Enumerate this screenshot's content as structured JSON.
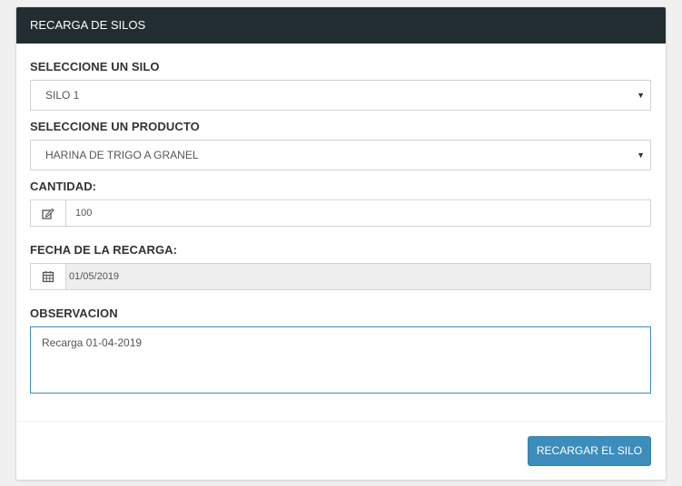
{
  "panel": {
    "title": "RECARGA DE SILOS"
  },
  "form": {
    "silo": {
      "label": "SELECCIONE UN SILO",
      "selected": "SILO 1"
    },
    "producto": {
      "label": "SELECCIONE UN PRODUCTO",
      "selected": "HARINA DE TRIGO A GRANEL"
    },
    "cantidad": {
      "label": "CANTIDAD:",
      "value": "100",
      "icon": "edit-icon"
    },
    "fecha": {
      "label": "FECHA DE LA RECARGA:",
      "value": "01/05/2019",
      "icon": "calendar-icon"
    },
    "observacion": {
      "label": "OBSERVACION",
      "value": "Recarga 01-04-2019"
    }
  },
  "actions": {
    "submit_label": "RECARGAR EL SILO"
  },
  "colors": {
    "header_bg": "#222d32",
    "primary": "#3c8dbc",
    "focus_border": "#3c8dbc"
  }
}
